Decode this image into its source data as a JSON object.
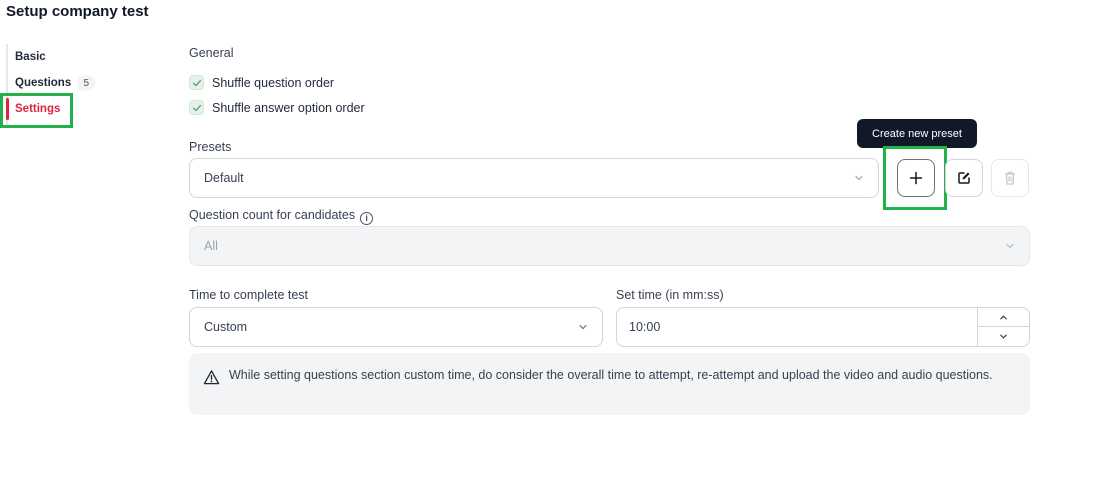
{
  "page_title": "Setup company test",
  "sidebar": {
    "items": [
      {
        "label": "Basic"
      },
      {
        "label": "Questions",
        "badge": "5"
      },
      {
        "label": "Settings",
        "active": true
      }
    ]
  },
  "general": {
    "heading": "General",
    "options": [
      {
        "label": "Shuffle question order",
        "checked": true
      },
      {
        "label": "Shuffle answer option order",
        "checked": true
      }
    ]
  },
  "presets": {
    "label": "Presets",
    "selected": "Default",
    "tooltip": "Create new preset",
    "buttons": {
      "create_icon": "plus-icon",
      "edit_icon": "edit-icon",
      "delete_icon": "trash-icon"
    }
  },
  "question_count": {
    "label": "Question count for candidates",
    "selected": "All",
    "disabled": true
  },
  "time": {
    "label": "Time to complete test",
    "selected": "Custom",
    "set_time_label": "Set time (in mm:ss)",
    "set_time_value": "10:00"
  },
  "notice": {
    "text": "While setting questions section custom time, do consider the overall time to attempt, re-attempt and upload the video and audio questions."
  },
  "colors": {
    "accent_active": "#dc2640",
    "highlight_box": "#22b14c",
    "checkbox_bg": "#e3f3ea",
    "tooltip_bg": "#111827"
  }
}
